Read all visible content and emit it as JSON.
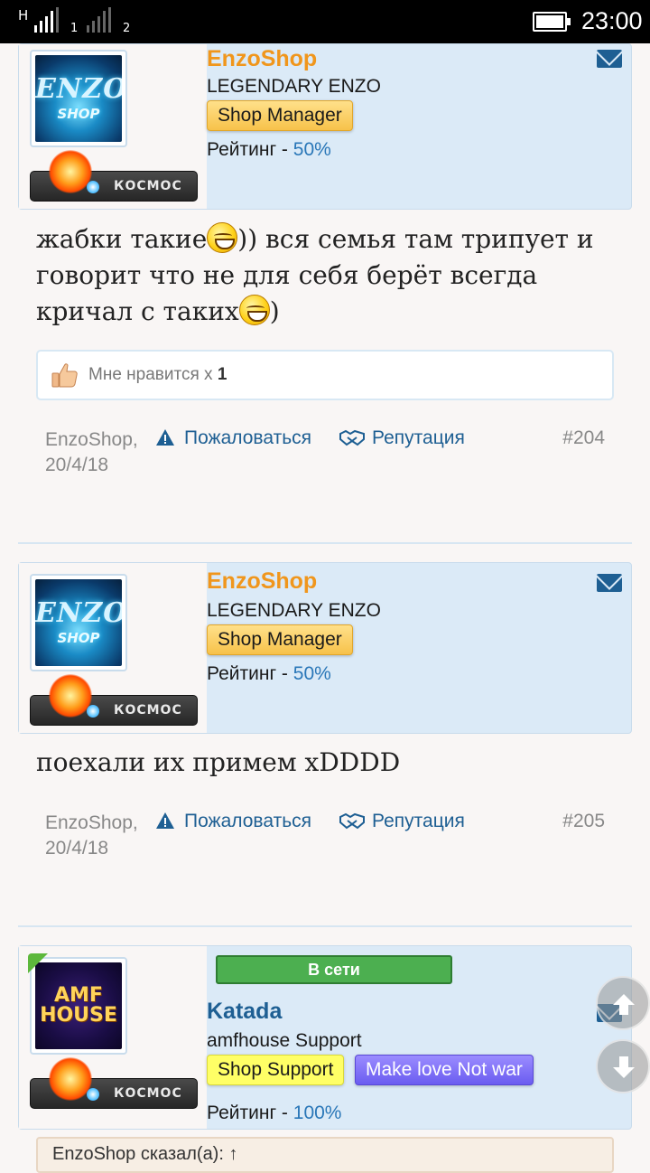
{
  "statusbar": {
    "sim1_label": "H",
    "sim1_index": "1",
    "sim2_index": "2",
    "time": "23:00"
  },
  "posts": [
    {
      "username": "EnzoShop",
      "user_title": "LEGENDARY ENZO",
      "badges": [
        "Shop Manager"
      ],
      "rating_label": "Рейтинг - ",
      "rating_value": "50%",
      "avatar_text_1": "ENZO",
      "avatar_text_2": "SHOP",
      "rank_label": "КОСМОС",
      "message_parts": [
        "жабки такие",
        ")) вся семья там трипует и говорит что не для себя берёт всегда кричал с таких",
        ")"
      ],
      "likes_label": "Мне нравится х ",
      "likes_count": "1",
      "author_date": "EnzoShop,",
      "date": "20/4/18",
      "report": "Пожаловаться",
      "reputation": "Репутация",
      "number": "#204"
    },
    {
      "username": "EnzoShop",
      "user_title": "LEGENDARY ENZO",
      "badges": [
        "Shop Manager"
      ],
      "rating_label": "Рейтинг - ",
      "rating_value": "50%",
      "avatar_text_1": "ENZO",
      "avatar_text_2": "SHOP",
      "rank_label": "КОСМОС",
      "message": "поехали их примем xDDDD",
      "author_date": "EnzoShop,",
      "date": "20/4/18",
      "report": "Пожаловаться",
      "reputation": "Репутация",
      "number": "#205"
    },
    {
      "online_label": "В сети",
      "username": "Katada",
      "user_title": "amfhouse Support",
      "badges": [
        "Shop Support",
        "Make love Not war"
      ],
      "rating_label": "Рейтинг - ",
      "rating_value": "100%",
      "avatar_text_1": "AMF",
      "avatar_text_2": "HOUSE",
      "rank_label": "КОСМОС",
      "quote_header": "EnzoShop сказал(а): ↑"
    }
  ],
  "colors": {
    "username_orange": "#f0961c",
    "username_blue": "#1e5f93",
    "link_blue": "#1e5f93",
    "userbox_bg": "#dbeaf7",
    "online_green": "#4caf50"
  },
  "icons": [
    "mail-icon",
    "warning-icon",
    "handshake-icon",
    "thumbs-up-icon",
    "scroll-up-icon",
    "scroll-down-icon"
  ]
}
